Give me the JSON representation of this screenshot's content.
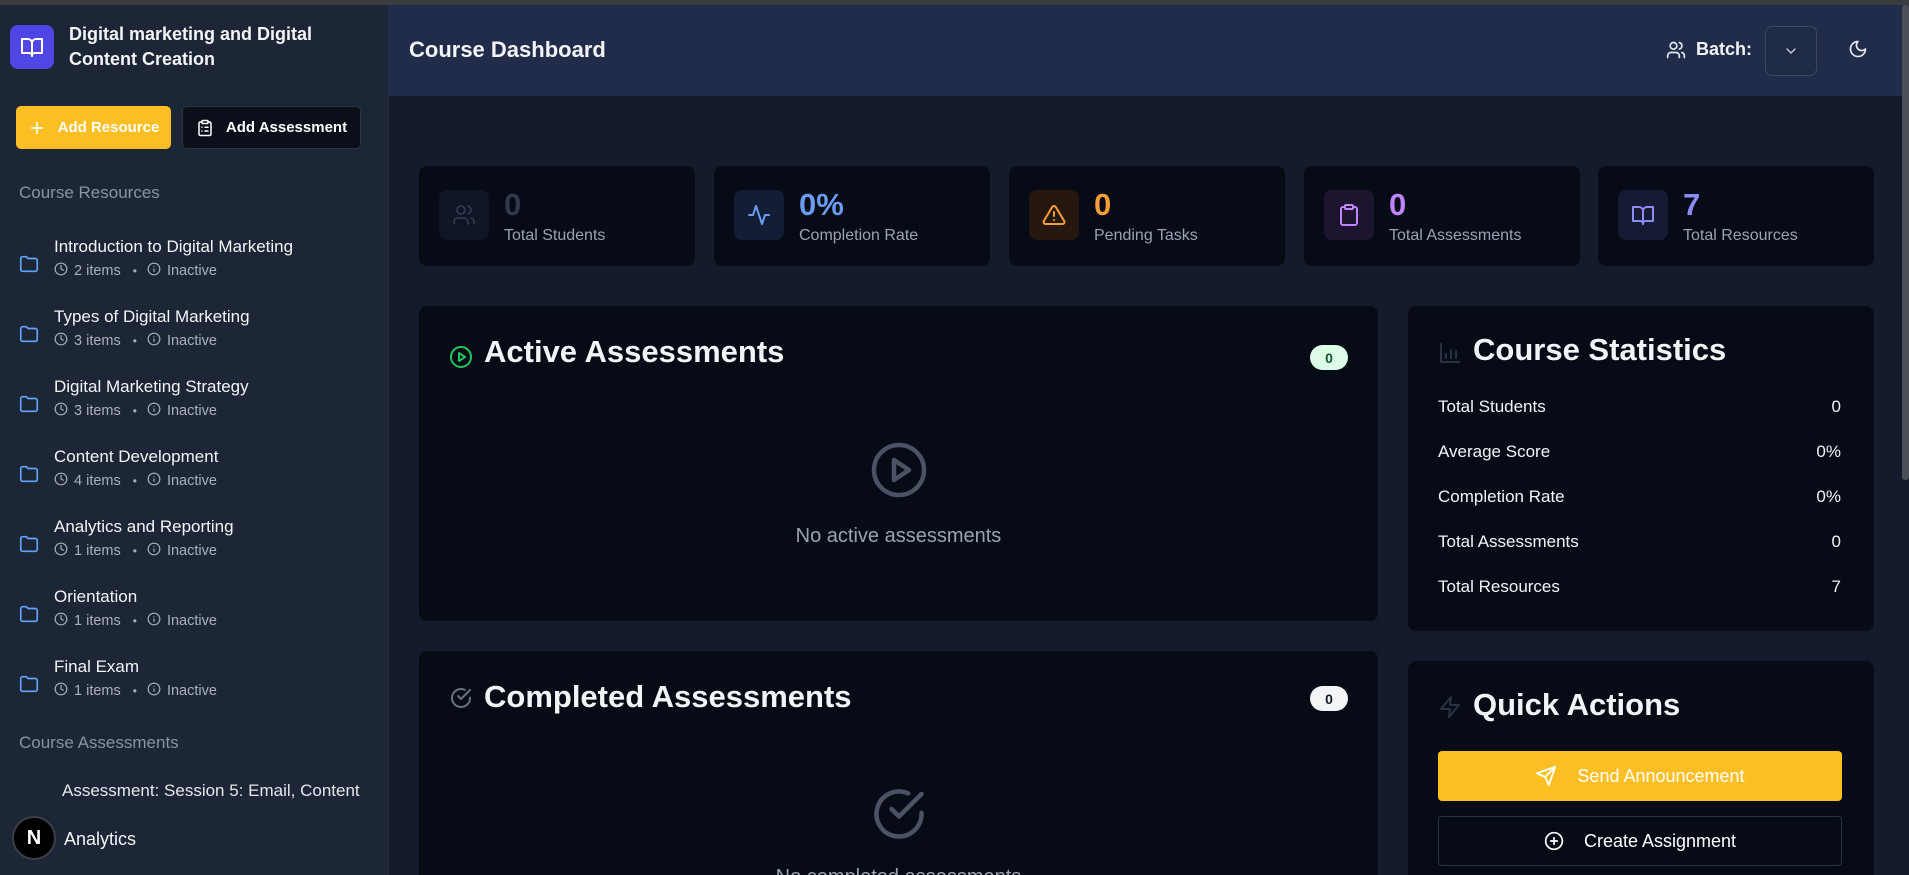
{
  "sidebar": {
    "course_title": "Digital marketing and Digital Content Creation",
    "add_resource_label": "Add Resource",
    "add_assessment_label": "Add Assessment",
    "resources_section_title": "Course Resources",
    "resources": [
      {
        "name": "Introduction to Digital Marketing",
        "items": "2 items",
        "status": "Inactive"
      },
      {
        "name": "Types of Digital Marketing",
        "items": "3 items",
        "status": "Inactive"
      },
      {
        "name": "Digital Marketing Strategy",
        "items": "3 items",
        "status": "Inactive"
      },
      {
        "name": "Content Development",
        "items": "4 items",
        "status": "Inactive"
      },
      {
        "name": "Analytics and Reporting",
        "items": "1 items",
        "status": "Inactive"
      },
      {
        "name": "Orientation",
        "items": "1 items",
        "status": "Inactive"
      },
      {
        "name": "Final Exam",
        "items": "1 items",
        "status": "Inactive"
      }
    ],
    "assessments_section_title": "Course Assessments",
    "assessment_item": "Assessment: Session 5: Email, Content",
    "avatar_letter": "N",
    "analytics_label": "Analytics"
  },
  "header": {
    "title": "Course Dashboard",
    "batch_label": "Batch:"
  },
  "stats": [
    {
      "value": "0",
      "label": "Total Students",
      "color": "#2f3a4f"
    },
    {
      "value": "0%",
      "label": "Completion Rate",
      "color": "#6b9cf2"
    },
    {
      "value": "0",
      "label": "Pending Tasks",
      "color": "#f59e3a"
    },
    {
      "value": "0",
      "label": "Total Assessments",
      "color": "#c084fc"
    },
    {
      "value": "7",
      "label": "Total Resources",
      "color": "#8b8cf5"
    }
  ],
  "active_assessments": {
    "title": "Active Assessments",
    "count": "0",
    "empty_text": "No active assessments"
  },
  "completed_assessments": {
    "title": "Completed Assessments",
    "count": "0",
    "empty_text": "No completed assessments"
  },
  "course_statistics": {
    "title": "Course Statistics",
    "rows": [
      {
        "label": "Total Students",
        "value": "0"
      },
      {
        "label": "Average Score",
        "value": "0%"
      },
      {
        "label": "Completion Rate",
        "value": "0%"
      },
      {
        "label": "Total Assessments",
        "value": "0"
      },
      {
        "label": "Total Resources",
        "value": "7"
      }
    ]
  },
  "quick_actions": {
    "title": "Quick Actions",
    "send_announcement_label": "Send Announcement",
    "create_assignment_label": "Create Assignment"
  },
  "colors": {
    "accent_yellow": "#fbbf24",
    "brand_indigo": "#4f46e5",
    "header_bg": "#202c4a",
    "panel_bg": "#070b16"
  }
}
